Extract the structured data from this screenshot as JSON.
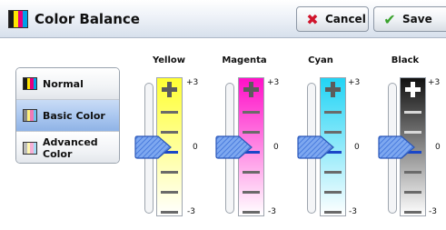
{
  "header": {
    "title": "Color Balance",
    "cancel_label": "Cancel",
    "save_label": "Save"
  },
  "modes": [
    {
      "label": "Normal",
      "selected": false
    },
    {
      "label": "Basic Color",
      "selected": true
    },
    {
      "label": "Advanced Color",
      "selected": false
    }
  ],
  "channels": [
    {
      "name": "Yellow",
      "color": "#ffff33",
      "value": 0
    },
    {
      "name": "Magenta",
      "color": "#ff10c8",
      "value": 0
    },
    {
      "name": "Cyan",
      "color": "#22d4f5",
      "value": 0
    },
    {
      "name": "Black",
      "color": "#111111",
      "value": 0
    }
  ],
  "scale_labels": {
    "max": "+3",
    "mid": "0",
    "min": "-3"
  },
  "icons": {
    "cancel": "x-icon",
    "save": "checkmark-icon",
    "app": "color-balance-icon"
  }
}
